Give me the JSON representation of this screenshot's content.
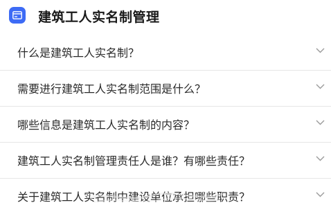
{
  "header": {
    "title": "建筑工人实名制管理",
    "icon": "id-card-icon",
    "accent_color": "#3d6bf5"
  },
  "faq": {
    "items": [
      {
        "question": "什么是建筑工人实名制？",
        "icon": "chevron-down-icon"
      },
      {
        "question": "需要进行建筑工人实名制范围是什么？",
        "icon": "chevron-down-icon"
      },
      {
        "question": "哪些信息是建筑工人实名制的内容？",
        "icon": "chevron-down-icon"
      },
      {
        "question": "建筑工人实名制管理责任人是谁？有哪些责任？",
        "icon": "chevron-down-icon"
      },
      {
        "question": "关于建筑工人实名制中建设单位承担哪些职责？",
        "icon": "chevron-down-icon"
      }
    ]
  }
}
